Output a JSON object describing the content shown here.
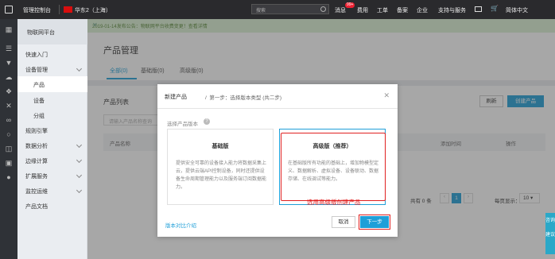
{
  "topbar": {
    "console": "管理控制台",
    "region": "华东2（上海）",
    "search_placeholder": "搜索",
    "messages": "消息",
    "message_badge": "99+",
    "fees": "费用",
    "tickets": "工单",
    "filing": "备案",
    "enterprise": "企业",
    "support": "支持与服务",
    "language": "简体中文"
  },
  "sidebar": {
    "title": "物联网平台",
    "items": [
      {
        "label": "快速入门"
      },
      {
        "label": "设备管理"
      },
      {
        "label": "产品"
      },
      {
        "label": "设备"
      },
      {
        "label": "分组"
      },
      {
        "label": "规则引擎"
      },
      {
        "label": "数据分析"
      },
      {
        "label": "边缘计算"
      },
      {
        "label": "扩展服务"
      },
      {
        "label": "监控运维"
      },
      {
        "label": "产品文档"
      }
    ]
  },
  "notice": {
    "text": "2019-01-14发布公告：物联网平台收费变更！查看详情"
  },
  "header": {
    "title": "产品管理",
    "tabs": [
      {
        "label": "全部(0)"
      },
      {
        "label": "基础版(0)"
      },
      {
        "label": "高级版(0)"
      }
    ]
  },
  "list": {
    "title": "产品列表",
    "refresh": "刷新",
    "create": "创建产品",
    "search_placeholder": "请输入产品名称查询",
    "columns": [
      "产品名称",
      "添加时间",
      "操作"
    ],
    "total": "共有 0 条",
    "page": "1",
    "page_size_label": "每页显示：",
    "page_size": "10"
  },
  "modal": {
    "title": "新建产品",
    "step": "第一步：选择版本类型 (共二步)",
    "select_label": "选择产品版本",
    "basic": {
      "title": "基础版",
      "desc": "提供安全可靠的设备接入能力将数据采集上云，提供云端API控制设备，同时还提供设备生命周期管理能力以及服务端订阅数据能力。"
    },
    "advanced": {
      "title": "高级版（推荐）",
      "desc": "在基础版所有功能的基础上，增加物模型定义、数据解析、虚拟设备、设备联动、数据存储、在线调试等能力。"
    },
    "compare_link": "版本对比介绍",
    "cancel": "取消",
    "next": "下一步"
  },
  "annotation": "选用高级版创建产品",
  "float": {
    "line1": "咨询",
    "line2": "建议"
  }
}
